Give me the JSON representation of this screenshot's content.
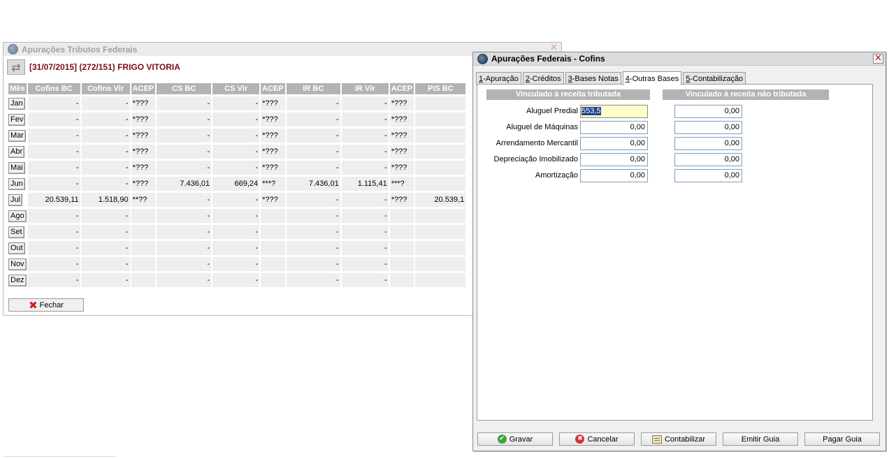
{
  "back_window": {
    "title": "Apurações Tributos Federais",
    "close_glyph": "✕",
    "swap_glyph": "⇄",
    "company_line": "[31/07/2015] (272/151) FRIGO VITORIA",
    "columns": [
      "Mês",
      "Cofins BC",
      "Cofins Vlr",
      "ACEP",
      "CS BC",
      "CS Vlr",
      "ACEP",
      "IR BC",
      "IR Vlr",
      "ACEP",
      "PIS BC"
    ],
    "rows": [
      {
        "month": "Jan",
        "cells": [
          "-",
          "-",
          "*???",
          "-",
          "-",
          "*???",
          "-",
          "-",
          "*???",
          ""
        ]
      },
      {
        "month": "Fev",
        "cells": [
          "-",
          "-",
          "*???",
          "-",
          "-",
          "*???",
          "-",
          "-",
          "*???",
          ""
        ]
      },
      {
        "month": "Mar",
        "cells": [
          "-",
          "-",
          "*???",
          "-",
          "-",
          "*???",
          "-",
          "-",
          "*???",
          ""
        ]
      },
      {
        "month": "Abr",
        "cells": [
          "-",
          "-",
          "*???",
          "-",
          "-",
          "*???",
          "-",
          "-",
          "*???",
          ""
        ]
      },
      {
        "month": "Mai",
        "cells": [
          "-",
          "-",
          "*???",
          "-",
          "-",
          "*???",
          "-",
          "-",
          "*???",
          ""
        ]
      },
      {
        "month": "Jun",
        "cells": [
          "-",
          "-",
          "*???",
          "7.436,01",
          "669,24",
          "***?",
          "7.436,01",
          "1.115,41",
          "***?",
          ""
        ]
      },
      {
        "month": "Jul",
        "cells": [
          "20.539,11",
          "1.518,90",
          "**??",
          "-",
          "-",
          "*???",
          "-",
          "-",
          "*???",
          "20.539,1"
        ]
      },
      {
        "month": "Ago",
        "cells": [
          "-",
          "-",
          "",
          "-",
          "-",
          "",
          "-",
          "-",
          "",
          ""
        ]
      },
      {
        "month": "Set",
        "cells": [
          "-",
          "-",
          "",
          "-",
          "-",
          "",
          "-",
          "-",
          "",
          ""
        ]
      },
      {
        "month": "Out",
        "cells": [
          "-",
          "-",
          "",
          "-",
          "-",
          "",
          "-",
          "-",
          "",
          ""
        ]
      },
      {
        "month": "Nov",
        "cells": [
          "-",
          "-",
          "",
          "-",
          "-",
          "",
          "-",
          "-",
          "",
          ""
        ]
      },
      {
        "month": "Dez",
        "cells": [
          "-",
          "-",
          "",
          "-",
          "-",
          "",
          "-",
          "-",
          "",
          ""
        ]
      }
    ],
    "fechar_label": "Fechar"
  },
  "front_window": {
    "title": "Apurações Federais - Cofins",
    "close_glyph": "✕",
    "tabs": [
      {
        "key": "1",
        "rest": "-Apuração"
      },
      {
        "key": "2",
        "rest": "-Créditos"
      },
      {
        "key": "3",
        "rest": "-Bases Notas"
      },
      {
        "key": "4",
        "rest": "-Outras Bases"
      },
      {
        "key": "5",
        "rest": "-Contabilização"
      }
    ],
    "active_tab": 3,
    "section_left": "Vinculado à receita tributada",
    "section_right": "Vinculado à receita não tributada",
    "fields": [
      {
        "label": "Aluguel Predial",
        "left": "553,5",
        "right": "0,00"
      },
      {
        "label": "Aluguel de Máquinas",
        "left": "0,00",
        "right": "0,00"
      },
      {
        "label": "Arrendamento Mercantil",
        "left": "0,00",
        "right": "0,00"
      },
      {
        "label": "Depreciação Imobilizado",
        "left": "0,00",
        "right": "0,00"
      },
      {
        "label": "Amortização",
        "left": "0,00",
        "right": "0,00"
      }
    ],
    "buttons": {
      "gravar": "Gravar",
      "cancelar": "Cancelar",
      "contabilizar": "Contabilizar",
      "emitir": "Emitir Guia",
      "pagar": "Pagar Guia"
    }
  }
}
